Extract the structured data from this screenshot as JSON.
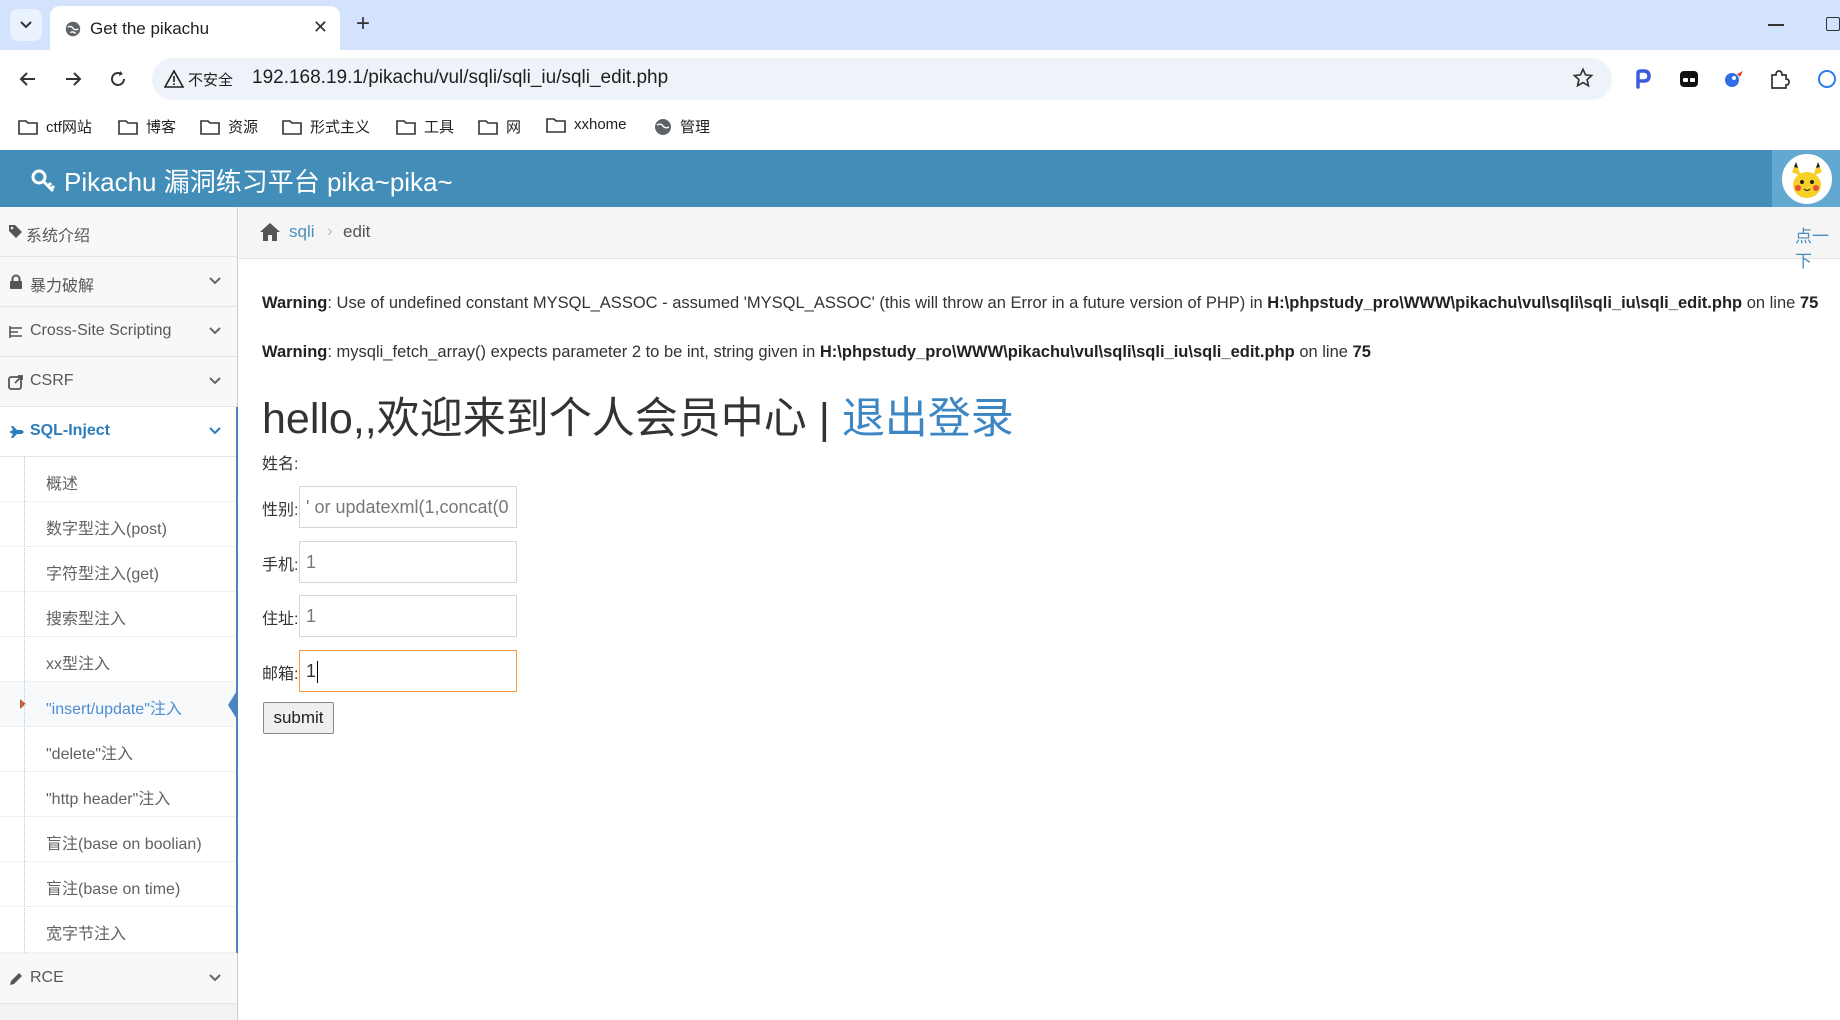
{
  "browser": {
    "tab_title": "Get the pikachu",
    "security_label": "不安全",
    "url": "192.168.19.1/pikachu/vul/sqli/sqli_iu/sqli_edit.php",
    "bookmarks": [
      "ctf网站",
      "博客",
      "资源",
      "形式主义",
      "工具",
      "网",
      "xxhome",
      "管理"
    ]
  },
  "header": {
    "title": "Pikachu 漏洞练习平台 pika~pika~"
  },
  "sidebar": {
    "items": [
      {
        "label": "系统介绍",
        "icon": "tags-icon"
      },
      {
        "label": "暴力破解",
        "icon": "lock-icon"
      },
      {
        "label": "Cross-Site Scripting",
        "icon": "list-icon"
      },
      {
        "label": "CSRF",
        "icon": "share-icon"
      },
      {
        "label": "SQL-Inject",
        "icon": "fighter-jet-icon"
      },
      {
        "label": "RCE",
        "icon": "pencil-icon"
      }
    ],
    "sql_sub": [
      "概述",
      "数字型注入(post)",
      "字符型注入(get)",
      "搜索型注入",
      "xx型注入",
      "\"insert/update\"注入",
      "\"delete\"注入",
      "\"http header\"注入",
      "盲注(base on boolian)",
      "盲注(base on time)",
      "宽字节注入"
    ]
  },
  "breadcrumb": {
    "link": "sqli",
    "separator": "›",
    "current": "edit",
    "right_link": "点一下"
  },
  "warnings": [
    {
      "label": "Warning",
      "message": ": Use of undefined constant MYSQL_ASSOC - assumed 'MYSQL_ASSOC' (this will throw an Error in a future version of PHP) in ",
      "file": "H:\\phpstudy_pro\\WWW\\pikachu\\vul\\sqli\\sqli_iu\\sqli_edit.php",
      "on_line": " on line ",
      "line": "75"
    },
    {
      "label": "Warning",
      "message": ": mysqli_fetch_array() expects parameter 2 to be int, string given in ",
      "file": "H:\\phpstudy_pro\\WWW\\pikachu\\vul\\sqli\\sqli_iu\\sqli_edit.php",
      "on_line": " on line ",
      "line": "75"
    }
  ],
  "main": {
    "hello": "hello,,欢迎来到个人会员中心 | ",
    "logout": "退出登录",
    "form": {
      "name_label": "姓名:",
      "sex_label": "性别:",
      "sex_value": "' or updatexml(1,concat(0",
      "phone_label": "手机:",
      "phone_value": "1",
      "address_label": "住址:",
      "address_value": "1",
      "email_label": "邮箱:",
      "email_value": "1",
      "submit": "submit"
    }
  },
  "colors": {
    "header_bg": "#438eb9",
    "link": "#4c8fbd",
    "active_menu": "#2b7dbc",
    "focus_border": "#f59942"
  }
}
